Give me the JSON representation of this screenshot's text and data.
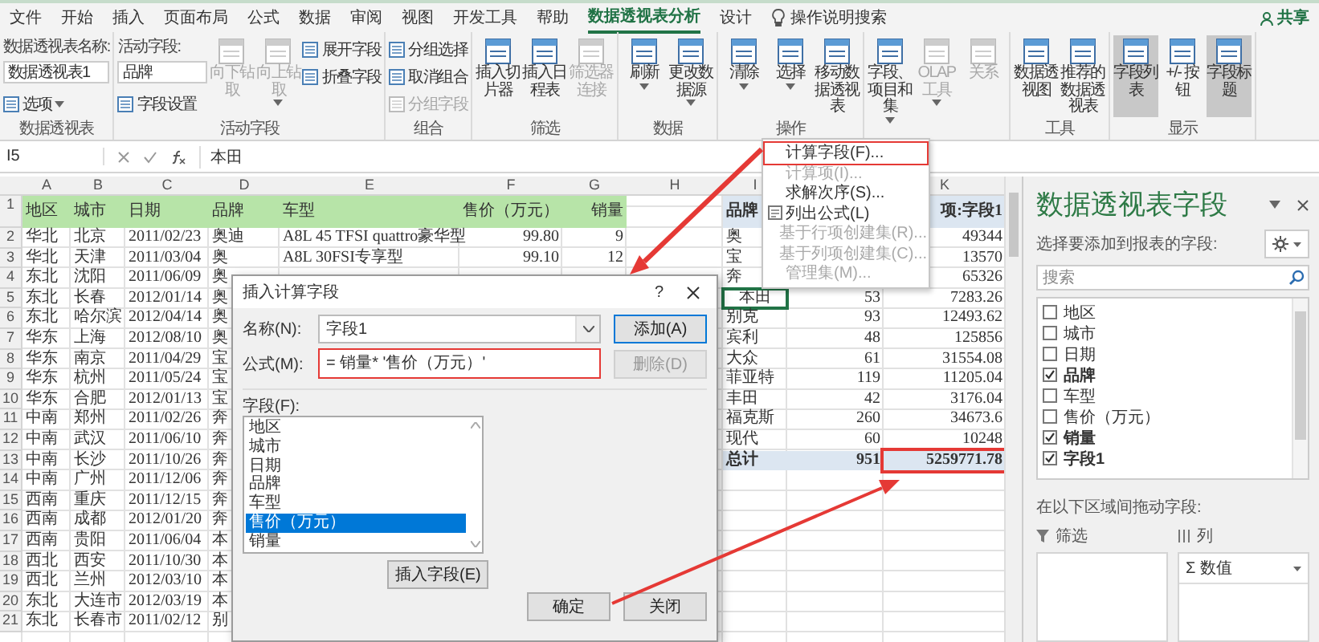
{
  "tabs": [
    {
      "label": "文件",
      "selected": false
    },
    {
      "label": "开始",
      "selected": false
    },
    {
      "label": "插入",
      "selected": false
    },
    {
      "label": "页面布局",
      "selected": false
    },
    {
      "label": "公式",
      "selected": false
    },
    {
      "label": "数据",
      "selected": false
    },
    {
      "label": "审阅",
      "selected": false
    },
    {
      "label": "视图",
      "selected": false
    },
    {
      "label": "开发工具",
      "selected": false
    },
    {
      "label": "帮助",
      "selected": false
    },
    {
      "label": "数据透视表分析",
      "selected": true
    },
    {
      "label": "设计",
      "selected": false
    }
  ],
  "tell_me": "操作说明搜索",
  "share": "共享",
  "ribbon": [
    {
      "label": "数据透视表",
      "items": [
        {
          "kind": "field",
          "label": "数据透视表名称:",
          "value": "数据透视表1"
        },
        {
          "kind": "small",
          "label": "选项",
          "disabled": false,
          "dropdown": true
        }
      ]
    },
    {
      "label": "活动字段",
      "items": [
        {
          "kind": "field",
          "label": "活动字段:",
          "value": "品牌"
        },
        {
          "kind": "small",
          "label": "字段设置",
          "disabled": false
        },
        {
          "kind": "big",
          "label": "向下钻取",
          "disabled": true
        },
        {
          "kind": "big",
          "label": "向上钻取",
          "disabled": true,
          "dropdown": true
        },
        {
          "kind": "small",
          "label": "展开字段",
          "disabled": false
        },
        {
          "kind": "small",
          "label": "折叠字段",
          "disabled": false
        }
      ]
    },
    {
      "label": "组合",
      "items": [
        {
          "kind": "small",
          "label": "分组选择",
          "disabled": false
        },
        {
          "kind": "small",
          "label": "取消组合",
          "disabled": false
        },
        {
          "kind": "small",
          "label": "分组字段",
          "disabled": true
        }
      ]
    },
    {
      "label": "筛选",
      "items": [
        {
          "kind": "big",
          "label": "插入切片器",
          "disabled": false
        },
        {
          "kind": "big",
          "label": "插入日程表",
          "disabled": false
        },
        {
          "kind": "big",
          "label": "筛选器连接",
          "disabled": true
        }
      ]
    },
    {
      "label": "数据",
      "items": [
        {
          "kind": "big",
          "label": "刷新",
          "disabled": false,
          "dropdown": true
        },
        {
          "kind": "big",
          "label": "更改数据源",
          "disabled": false,
          "dropdown": true
        }
      ]
    },
    {
      "label": "操作",
      "items": [
        {
          "kind": "big",
          "label": "清除",
          "disabled": false,
          "dropdown": true
        },
        {
          "kind": "big",
          "label": "选择",
          "disabled": false,
          "dropdown": true
        },
        {
          "kind": "big",
          "label": "移动数据透视表",
          "disabled": false
        }
      ]
    },
    {
      "items": [
        {
          "kind": "big",
          "label": "字段、项目和集",
          "disabled": false,
          "dropdown": true
        },
        {
          "kind": "big",
          "label": "OLAP 工具",
          "disabled": true,
          "dropdown": true
        },
        {
          "kind": "big",
          "label": "关系",
          "disabled": true
        }
      ]
    },
    {
      "label": "工具",
      "items": [
        {
          "kind": "big",
          "label": "数据透视图",
          "disabled": false
        },
        {
          "kind": "big",
          "label": "推荐的数据透视表",
          "disabled": false
        }
      ]
    },
    {
      "label": "显示",
      "items": [
        {
          "kind": "big",
          "label": "字段列表",
          "disabled": false,
          "selected": true
        },
        {
          "kind": "big",
          "label": "+/- 按钮",
          "disabled": false,
          "selected": false
        },
        {
          "kind": "big",
          "label": "字段标题",
          "disabled": false,
          "selected": true
        }
      ]
    }
  ],
  "formula_bar": {
    "cell": "I5",
    "value": "本田"
  },
  "column_headers": [
    "A",
    "B",
    "C",
    "D",
    "E",
    "F",
    "G",
    "H",
    "I"
  ],
  "last_column_header": "K",
  "sheet_rows": [
    {
      "num": "1",
      "cells": [
        "地区",
        "城市",
        "日期",
        "品牌",
        "车型",
        "售价（万元）",
        "销量"
      ]
    },
    {
      "num": "2",
      "cells": [
        "华北",
        "北京",
        "2011/02/23",
        "奥迪",
        "A8L 45 TFSI quattro豪华型",
        "99.80",
        "9"
      ]
    },
    {
      "num": "3",
      "cells": [
        "华北",
        "天津",
        "2011/03/04",
        "奥",
        "A8L 30FSI专享型",
        "99.10",
        "12"
      ]
    },
    {
      "num": "4",
      "cells": [
        "东北",
        "沈阳",
        "2011/06/09",
        "奥"
      ]
    },
    {
      "num": "5",
      "cells": [
        "东北",
        "长春",
        "2012/01/14",
        "奥"
      ]
    },
    {
      "num": "6",
      "cells": [
        "东北",
        "哈尔滨",
        "2012/04/14",
        "奥"
      ]
    },
    {
      "num": "7",
      "cells": [
        "华东",
        "上海",
        "2012/08/10",
        "奥"
      ]
    },
    {
      "num": "8",
      "cells": [
        "华东",
        "南京",
        "2011/04/29",
        "宝"
      ]
    },
    {
      "num": "9",
      "cells": [
        "华东",
        "杭州",
        "2011/05/24",
        "宝"
      ]
    },
    {
      "num": "10",
      "cells": [
        "华东",
        "合肥",
        "2012/01/13",
        "宝"
      ]
    },
    {
      "num": "11",
      "cells": [
        "中南",
        "郑州",
        "2011/02/26",
        "奔"
      ]
    },
    {
      "num": "12",
      "cells": [
        "中南",
        "武汉",
        "2011/06/10",
        "奔"
      ]
    },
    {
      "num": "13",
      "cells": [
        "中南",
        "长沙",
        "2011/10/26",
        "奔"
      ]
    },
    {
      "num": "14",
      "cells": [
        "中南",
        "广州",
        "2011/12/06",
        "奔"
      ]
    },
    {
      "num": "15",
      "cells": [
        "西南",
        "重庆",
        "2011/12/15",
        "奔"
      ]
    },
    {
      "num": "16",
      "cells": [
        "西南",
        "成都",
        "2012/01/20",
        "奔"
      ]
    },
    {
      "num": "17",
      "cells": [
        "西南",
        "贵阳",
        "2011/06/04",
        "本"
      ]
    },
    {
      "num": "18",
      "cells": [
        "西北",
        "西安",
        "2011/10/30",
        "本"
      ]
    },
    {
      "num": "19",
      "cells": [
        "西北",
        "兰州",
        "2012/03/10",
        "本"
      ]
    },
    {
      "num": "20",
      "cells": [
        "东北",
        "大连市",
        "2012/03/19",
        "本"
      ]
    },
    {
      "num": "21",
      "cells": [
        "东北",
        "长春市",
        "2011/02/12",
        "别"
      ]
    }
  ],
  "pivot": {
    "row_label": "品牌",
    "value_header": "项:字段1",
    "rows": [
      {
        "label": "奥",
        "sum": "49344",
        "selected": false
      },
      {
        "label": "宝",
        "sum": "13570",
        "selected": false
      },
      {
        "label": "奔",
        "sum": "65326",
        "selected": false
      },
      {
        "label": "本田",
        "count": "53",
        "sum": "7283.26",
        "selected": true
      },
      {
        "label": "别克",
        "count": "93",
        "sum": "12493.62",
        "selected": false
      },
      {
        "label": "宾利",
        "count": "48",
        "sum": "125856",
        "selected": false
      },
      {
        "label": "大众",
        "count": "61",
        "sum": "31554.08",
        "selected": false
      },
      {
        "label": "菲亚特",
        "count": "119",
        "sum": "11205.04",
        "selected": false
      },
      {
        "label": "丰田",
        "count": "42",
        "sum": "3176.04",
        "selected": false
      },
      {
        "label": "福克斯",
        "count": "260",
        "sum": "34673.6",
        "selected": false
      },
      {
        "label": "现代",
        "count": "60",
        "sum": "10248",
        "selected": false
      }
    ],
    "total": {
      "label": "总计",
      "count": "951",
      "sum": "5259771.78",
      "highlighted": true
    }
  },
  "context_menu": [
    {
      "label": "计算字段(F)...",
      "kind": "plain",
      "disabled": false,
      "highlighted": true
    },
    {
      "label": "计算项(I)...",
      "kind": "plain",
      "disabled": true,
      "highlighted": false
    },
    {
      "label": "求解次序(S)...",
      "kind": "plain",
      "disabled": false,
      "highlighted": false
    },
    {
      "label": "列出公式(L)",
      "kind": "with-icon",
      "disabled": false,
      "highlighted": false
    },
    {
      "label": "基于行项创建集(R)...",
      "kind": "plain",
      "disabled": true,
      "highlighted": false
    },
    {
      "label": "基于列项创建集(C)...",
      "kind": "plain",
      "disabled": true,
      "highlighted": false
    },
    {
      "label": "管理集(M)...",
      "kind": "plain",
      "disabled": true,
      "highlighted": false
    }
  ],
  "dialog": {
    "title": "插入计算字段",
    "help": "?",
    "name_label": "名称(N):",
    "name_value": "字段1",
    "formula_label": "公式(M):",
    "formula_value": "= 销量* '售价（万元）'",
    "formula_highlighted": true,
    "buttons": [
      {
        "label": "添加(A)",
        "disabled": false,
        "default": true
      },
      {
        "label": "删除(D)",
        "disabled": true,
        "default": false
      }
    ],
    "fields_label": "字段(F):",
    "fields": [
      {
        "label": "地区",
        "selected": false
      },
      {
        "label": "城市",
        "selected": false
      },
      {
        "label": "日期",
        "selected": false
      },
      {
        "label": "品牌",
        "selected": false
      },
      {
        "label": "车型",
        "selected": false
      },
      {
        "label": "售价（万元）",
        "selected": true
      },
      {
        "label": "销量",
        "selected": false
      }
    ],
    "insert_button": "插入字段(E)",
    "ok": "确定",
    "close": "关闭"
  },
  "pane": {
    "title": "数据透视表字段",
    "subtitle": "选择要添加到报表的字段:",
    "search_placeholder": "搜索",
    "fields": [
      {
        "label": "地区",
        "checked": false
      },
      {
        "label": "城市",
        "checked": false
      },
      {
        "label": "日期",
        "checked": false
      },
      {
        "label": "品牌",
        "checked": true
      },
      {
        "label": "车型",
        "checked": false
      },
      {
        "label": "售价（万元）",
        "checked": false
      },
      {
        "label": "销量",
        "checked": true
      },
      {
        "label": "字段1",
        "checked": true
      }
    ],
    "areas_hint": "在以下区域间拖动字段:",
    "areas": [
      {
        "label": "筛选",
        "kind": "filter"
      },
      {
        "label": "列",
        "kind": "columns",
        "items": [
          "Σ 数值"
        ]
      }
    ]
  }
}
